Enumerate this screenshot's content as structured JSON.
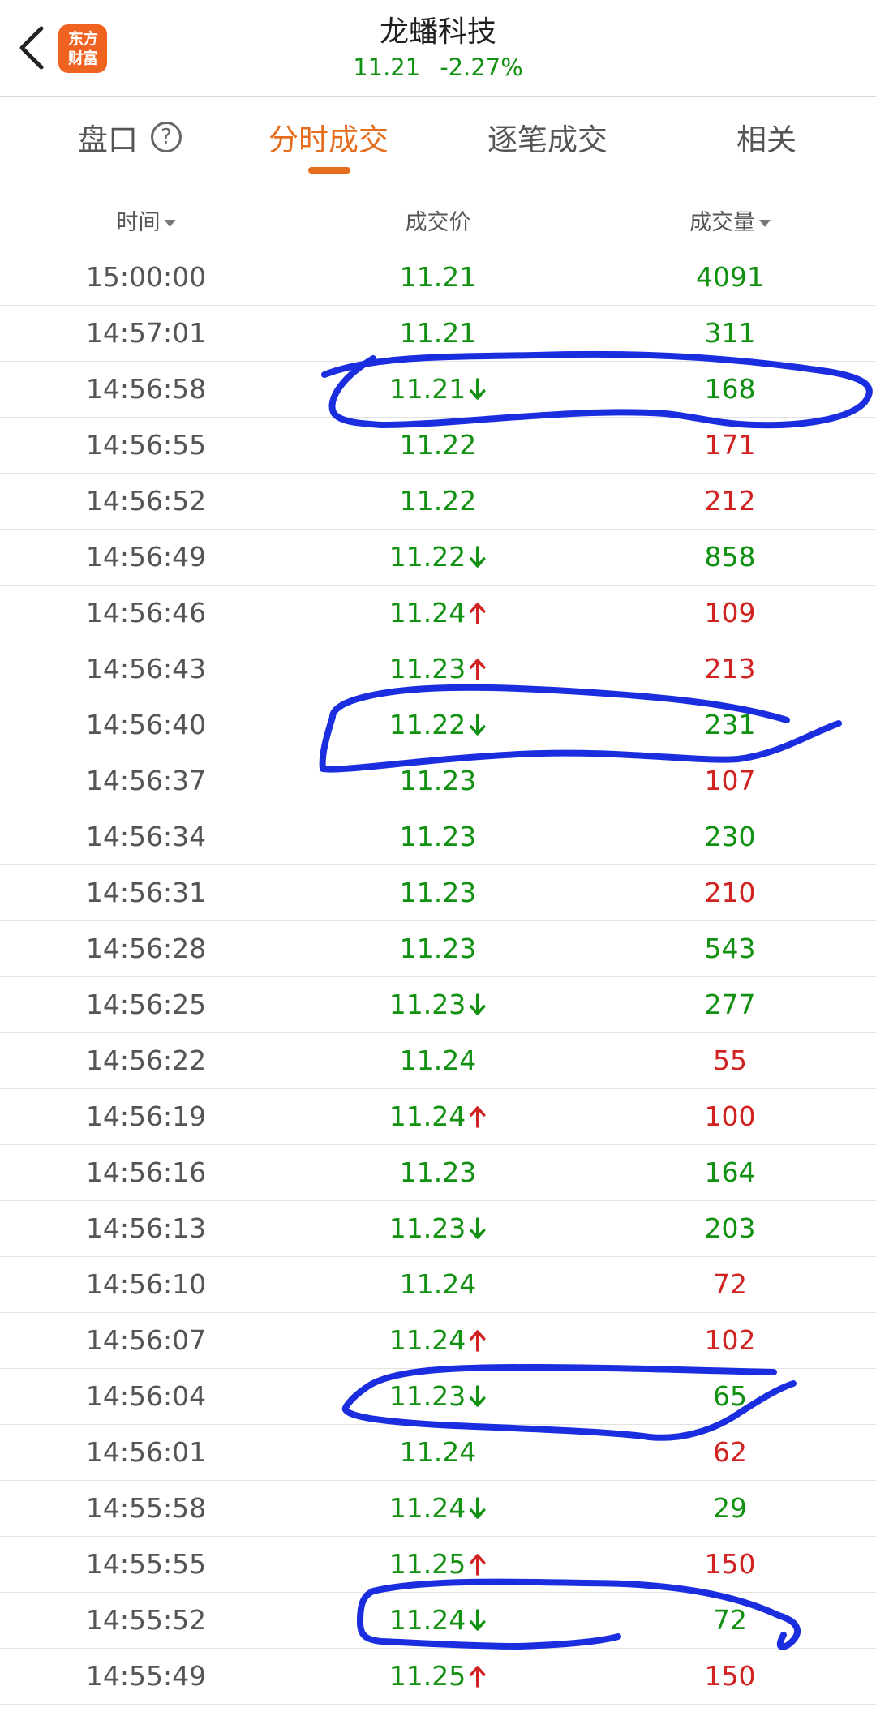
{
  "header": {
    "back_icon": "chevron-left-icon",
    "logo_line1": "东方",
    "logo_line2": "财富",
    "title": "龙蟠科技",
    "price": "11.21",
    "change": "-2.27%"
  },
  "tabs": [
    {
      "label": "盘口",
      "active": false
    },
    {
      "label": "分时成交",
      "active": true
    },
    {
      "label": "逐笔成交",
      "active": false
    },
    {
      "label": "相关",
      "active": false
    }
  ],
  "columns": {
    "time": "时间",
    "price": "成交价",
    "volume": "成交量"
  },
  "colors": {
    "up": "#d12222",
    "down": "#129012",
    "accent": "#e56d1e",
    "annotation": "#1a2ee0"
  },
  "rows": [
    {
      "time": "15:00:00",
      "price": "11.21",
      "dir": "",
      "vol": "4091",
      "vol_color": "green"
    },
    {
      "time": "14:57:01",
      "price": "11.21",
      "dir": "",
      "vol": "311",
      "vol_color": "green"
    },
    {
      "time": "14:56:58",
      "price": "11.21",
      "dir": "down",
      "vol": "168",
      "vol_color": "green"
    },
    {
      "time": "14:56:55",
      "price": "11.22",
      "dir": "",
      "vol": "171",
      "vol_color": "red"
    },
    {
      "time": "14:56:52",
      "price": "11.22",
      "dir": "",
      "vol": "212",
      "vol_color": "red"
    },
    {
      "time": "14:56:49",
      "price": "11.22",
      "dir": "down",
      "vol": "858",
      "vol_color": "green"
    },
    {
      "time": "14:56:46",
      "price": "11.24",
      "dir": "up",
      "vol": "109",
      "vol_color": "red"
    },
    {
      "time": "14:56:43",
      "price": "11.23",
      "dir": "up",
      "vol": "213",
      "vol_color": "red"
    },
    {
      "time": "14:56:40",
      "price": "11.22",
      "dir": "down",
      "vol": "231",
      "vol_color": "green"
    },
    {
      "time": "14:56:37",
      "price": "11.23",
      "dir": "",
      "vol": "107",
      "vol_color": "red"
    },
    {
      "time": "14:56:34",
      "price": "11.23",
      "dir": "",
      "vol": "230",
      "vol_color": "green"
    },
    {
      "time": "14:56:31",
      "price": "11.23",
      "dir": "",
      "vol": "210",
      "vol_color": "red"
    },
    {
      "time": "14:56:28",
      "price": "11.23",
      "dir": "",
      "vol": "543",
      "vol_color": "green"
    },
    {
      "time": "14:56:25",
      "price": "11.23",
      "dir": "down",
      "vol": "277",
      "vol_color": "green"
    },
    {
      "time": "14:56:22",
      "price": "11.24",
      "dir": "",
      "vol": "55",
      "vol_color": "red"
    },
    {
      "time": "14:56:19",
      "price": "11.24",
      "dir": "up",
      "vol": "100",
      "vol_color": "red"
    },
    {
      "time": "14:56:16",
      "price": "11.23",
      "dir": "",
      "vol": "164",
      "vol_color": "green"
    },
    {
      "time": "14:56:13",
      "price": "11.23",
      "dir": "down",
      "vol": "203",
      "vol_color": "green"
    },
    {
      "time": "14:56:10",
      "price": "11.24",
      "dir": "",
      "vol": "72",
      "vol_color": "red"
    },
    {
      "time": "14:56:07",
      "price": "11.24",
      "dir": "up",
      "vol": "102",
      "vol_color": "red"
    },
    {
      "time": "14:56:04",
      "price": "11.23",
      "dir": "down",
      "vol": "65",
      "vol_color": "green"
    },
    {
      "time": "14:56:01",
      "price": "11.24",
      "dir": "",
      "vol": "62",
      "vol_color": "red"
    },
    {
      "time": "14:55:58",
      "price": "11.24",
      "dir": "down",
      "vol": "29",
      "vol_color": "green"
    },
    {
      "time": "14:55:55",
      "price": "11.25",
      "dir": "up",
      "vol": "150",
      "vol_color": "red"
    },
    {
      "time": "14:55:52",
      "price": "11.24",
      "dir": "down",
      "vol": "72",
      "vol_color": "green"
    },
    {
      "time": "14:55:49",
      "price": "11.25",
      "dir": "up",
      "vol": "150",
      "vol_color": "red"
    }
  ]
}
